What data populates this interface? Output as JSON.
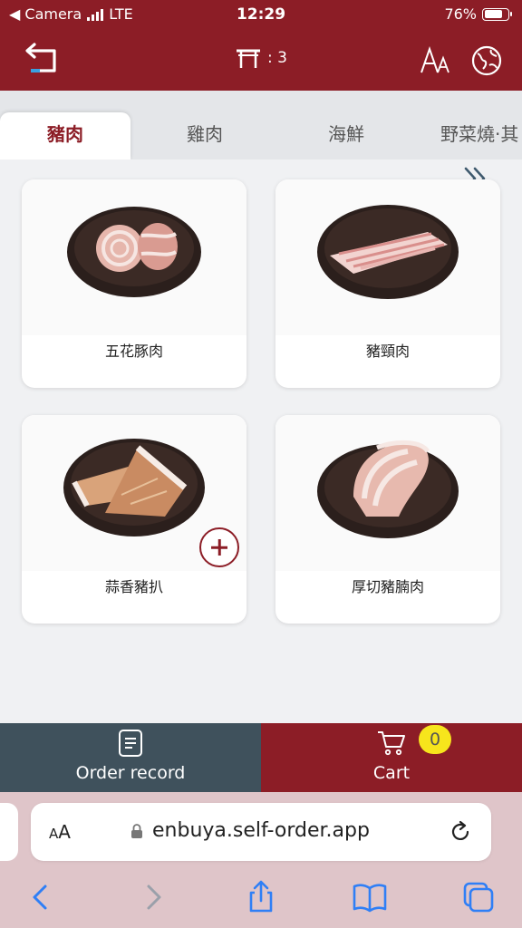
{
  "status_bar": {
    "back_app": "◀ Camera",
    "carrier": "LTE",
    "time": "12:29",
    "battery_pct": "76%",
    "battery_level": 0.76
  },
  "header": {
    "table_number": ": 3",
    "accent_color": "#8c1d26"
  },
  "tabs": [
    {
      "label": "豬肉",
      "active": true
    },
    {
      "label": "雞肉",
      "active": false
    },
    {
      "label": "海鮮",
      "active": false
    },
    {
      "label": "野菜燒·其",
      "active": false
    }
  ],
  "products": [
    {
      "name": "五花豚肉",
      "icon": "pork-belly-roll-photo"
    },
    {
      "name": "豬頸肉",
      "icon": "pork-neck-slices-photo"
    },
    {
      "name": "蒜香豬扒",
      "icon": "garlic-pork-chop-photo",
      "has_add_button": true
    },
    {
      "name": "厚切豬腩肉",
      "icon": "thick-pork-belly-photo"
    }
  ],
  "bottom_bar": {
    "order_record_label": "Order record",
    "cart_label": "Cart",
    "cart_count": "0",
    "order_color": "#3f515c",
    "badge_color": "#f7e51c"
  },
  "browser": {
    "aa_label": "A",
    "aa_label_small": "A",
    "url": "enbuya.self-order.app",
    "chrome_color": "#dfc5c9"
  }
}
